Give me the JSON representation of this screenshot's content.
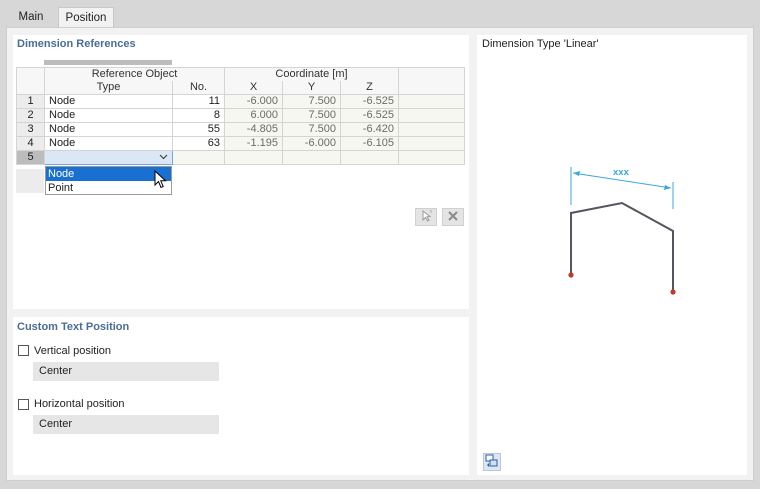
{
  "tabs": [
    {
      "label": "Main"
    },
    {
      "label": "Position"
    }
  ],
  "dimension_references": {
    "title": "Dimension References",
    "headers": {
      "reference_object": "Reference Object",
      "type": "Type",
      "no": "No.",
      "coordinate": "Coordinate [m]",
      "x": "X",
      "y": "Y",
      "z": "Z"
    },
    "rows": [
      {
        "num": "1",
        "type": "Node",
        "no": "11",
        "x": "-6.000",
        "y": "7.500",
        "z": "-6.525"
      },
      {
        "num": "2",
        "type": "Node",
        "no": "8",
        "x": "6.000",
        "y": "7.500",
        "z": "-6.525"
      },
      {
        "num": "3",
        "type": "Node",
        "no": "55",
        "x": "-4.805",
        "y": "7.500",
        "z": "-6.420"
      },
      {
        "num": "4",
        "type": "Node",
        "no": "63",
        "x": "-1.195",
        "y": "-6.000",
        "z": "-6.105"
      },
      {
        "num": "5",
        "type": "",
        "no": "",
        "x": "",
        "y": "",
        "z": ""
      }
    ],
    "dropdown_options": [
      "Node",
      "Point"
    ],
    "dropdown_selected": "Node"
  },
  "custom_text_position": {
    "title": "Custom Text Position",
    "vertical_label": "Vertical position",
    "vertical_checked": false,
    "vertical_value": "Center",
    "horizontal_label": "Horizontal position",
    "horizontal_checked": false,
    "horizontal_value": "Center"
  },
  "preview": {
    "title": "Dimension Type 'Linear'",
    "dimension_text": "xxx",
    "frame_color": "#55555f",
    "dimension_color": "#39a7e0",
    "support_color": "#c0392b"
  },
  "icons": {
    "pick_icon": "pick-cursor-icon",
    "delete_icon": "delete-x-icon",
    "view_icon": "view-settings-icon"
  }
}
